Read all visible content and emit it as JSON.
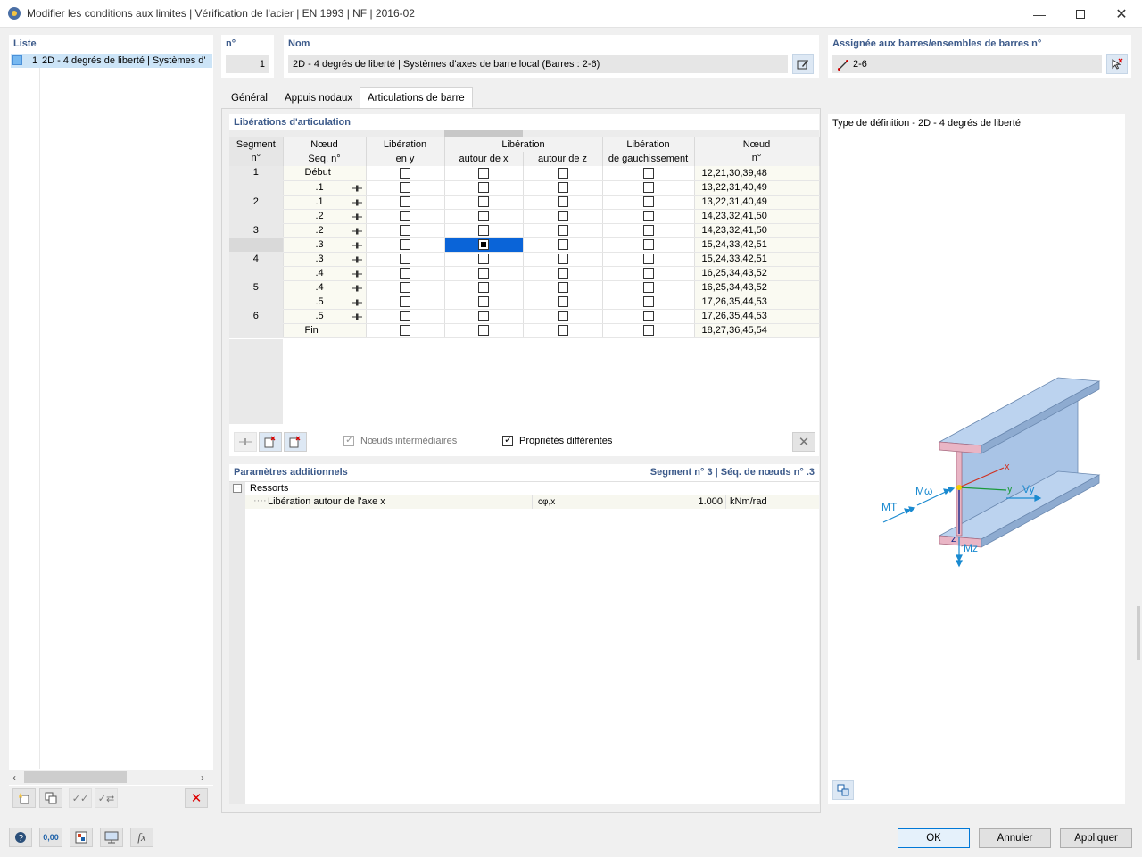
{
  "window": {
    "title": "Modifier les conditions aux limites | Vérification de l'acier | EN 1993 | NF | 2016-02",
    "minimize_icon": "minimize-icon",
    "maximize_icon": "maximize-icon",
    "close_icon": "close-icon"
  },
  "list": {
    "header": "Liste",
    "items": [
      {
        "number": "1",
        "label": "2D - 4 degrés de liberté | Systèmes d'"
      }
    ]
  },
  "number": {
    "header": "n°",
    "value": "1"
  },
  "name": {
    "header": "Nom",
    "value": "2D - 4 degrés de liberté | Systèmes d'axes de barre local (Barres : 2-6)"
  },
  "assigned": {
    "header": "Assignée aux barres/ensembles de barres n°",
    "value": "2-6"
  },
  "tabs": [
    "Général",
    "Appuis nodaux",
    "Articulations de barre"
  ],
  "active_tab": "Articulations de barre",
  "releases": {
    "title": "Libérations d'articulation",
    "columns": {
      "segment": [
        "Segment",
        "n°"
      ],
      "node_seq": [
        "Nœud",
        "Seq. n°"
      ],
      "lib_y": [
        "Libération",
        "en y"
      ],
      "lib_group": "Libération",
      "lib_x": "autour de x",
      "lib_z": "autour de z",
      "lib_warp": [
        "Libération",
        "de gauchissement"
      ],
      "node_no": [
        "Nœud",
        "n°"
      ]
    },
    "rows": [
      {
        "seg": "1",
        "seq": "Début",
        "hinge": false,
        "y": false,
        "x": false,
        "z": false,
        "w": false,
        "nodes": "12,21,30,39,48"
      },
      {
        "seg": "",
        "seq": ".1",
        "hinge": true,
        "y": false,
        "x": false,
        "z": false,
        "w": false,
        "nodes": "13,22,31,40,49"
      },
      {
        "seg": "2",
        "seq": ".1",
        "hinge": true,
        "y": false,
        "x": false,
        "z": false,
        "w": false,
        "nodes": "13,22,31,40,49"
      },
      {
        "seg": "",
        "seq": ".2",
        "hinge": true,
        "y": false,
        "x": false,
        "z": false,
        "w": false,
        "nodes": "14,23,32,41,50"
      },
      {
        "seg": "3",
        "seq": ".2",
        "hinge": true,
        "y": false,
        "x": false,
        "z": false,
        "w": false,
        "nodes": "14,23,32,41,50"
      },
      {
        "seg": "",
        "seq": ".3",
        "hinge": true,
        "y": false,
        "x": true,
        "z": false,
        "w": false,
        "nodes": "15,24,33,42,51",
        "selected": true
      },
      {
        "seg": "4",
        "seq": ".3",
        "hinge": true,
        "y": false,
        "x": false,
        "z": false,
        "w": false,
        "nodes": "15,24,33,42,51"
      },
      {
        "seg": "",
        "seq": ".4",
        "hinge": true,
        "y": false,
        "x": false,
        "z": false,
        "w": false,
        "nodes": "16,25,34,43,52"
      },
      {
        "seg": "5",
        "seq": ".4",
        "hinge": true,
        "y": false,
        "x": false,
        "z": false,
        "w": false,
        "nodes": "16,25,34,43,52"
      },
      {
        "seg": "",
        "seq": ".5",
        "hinge": true,
        "y": false,
        "x": false,
        "z": false,
        "w": false,
        "nodes": "17,26,35,44,53"
      },
      {
        "seg": "6",
        "seq": ".5",
        "hinge": true,
        "y": false,
        "x": false,
        "z": false,
        "w": false,
        "nodes": "17,26,35,44,53"
      },
      {
        "seg": "",
        "seq": "Fin",
        "hinge": false,
        "y": false,
        "x": false,
        "z": false,
        "w": false,
        "nodes": "18,27,36,45,54"
      }
    ],
    "intermediate_nodes_label": "Nœuds intermédiaires",
    "intermediate_nodes_checked": true,
    "different_props_label": "Propriétés différentes",
    "different_props_checked": true
  },
  "additional": {
    "title": "Paramètres additionnels",
    "context": "Segment n° 3 | Séq. de nœuds n° .3",
    "group": "Ressorts",
    "param_label": "Libération autour de l'axe x",
    "param_symbol": "cφ,x",
    "param_value": "1.000",
    "param_unit": "kNm/rad"
  },
  "definition": {
    "title": "Type de définition - 2D - 4 degrés de liberté",
    "labels": {
      "x": "x",
      "y": "y",
      "z": "z",
      "MT": "MT",
      "Mw": "Mω",
      "Vy": "Vy",
      "Mz": "Mz"
    }
  },
  "buttons": {
    "ok": "OK",
    "cancel": "Annuler",
    "apply": "Appliquer"
  },
  "colors": {
    "accent": "#0a64d8",
    "header_text": "#3c5a8a",
    "beam_blue": "#a9c4e6",
    "flange_pink": "#e9b5c5"
  }
}
